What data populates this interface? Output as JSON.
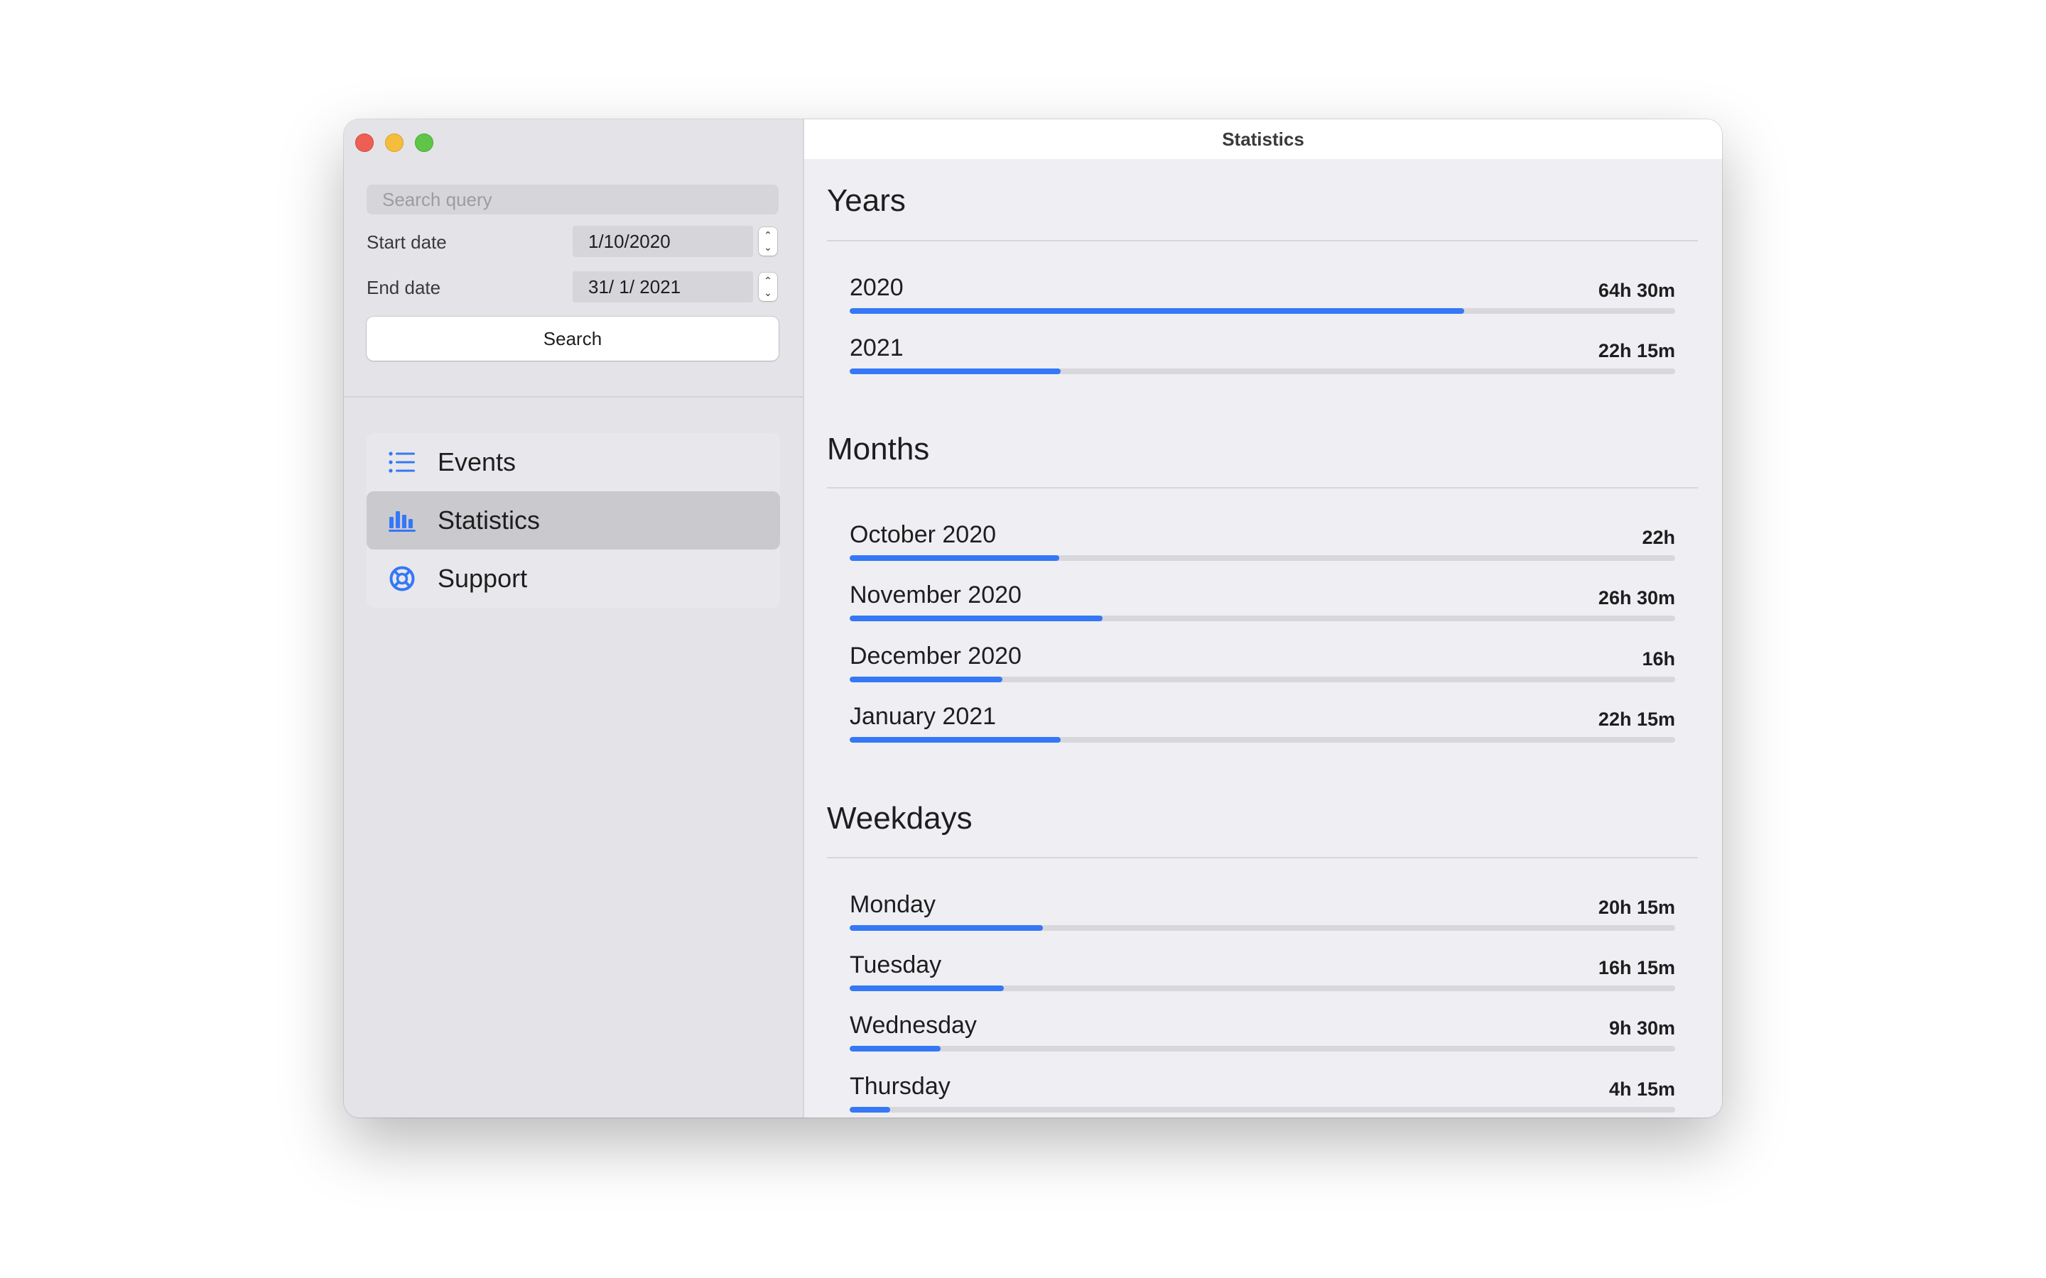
{
  "window_title": "Statistics",
  "colors": {
    "accent": "#3478f6",
    "close": "#ed5f55",
    "minimize": "#f4bd3b",
    "maximize": "#5ec548"
  },
  "sidebar": {
    "search": {
      "placeholder": "Search query",
      "value": ""
    },
    "start_date": {
      "label": "Start date",
      "value": "1/10/2020"
    },
    "end_date": {
      "label": "End date",
      "value": "31/  1/ 2021"
    },
    "search_button": "Search",
    "nav": [
      {
        "label": "Events",
        "icon": "list-icon",
        "selected": false
      },
      {
        "label": "Statistics",
        "icon": "bar-chart-icon",
        "selected": true
      },
      {
        "label": "Support",
        "icon": "lifebuoy-icon",
        "selected": false
      }
    ]
  },
  "main": {
    "years": {
      "title": "Years",
      "rows": [
        {
          "label": "2020",
          "value": "64h 30m",
          "fraction": 0.744
        },
        {
          "label": "2021",
          "value": "22h 15m",
          "fraction": 0.256
        }
      ]
    },
    "months": {
      "title": "Months",
      "rows": [
        {
          "label": "October 2020",
          "value": "22h",
          "fraction": 0.254
        },
        {
          "label": "November 2020",
          "value": "26h 30m",
          "fraction": 0.306
        },
        {
          "label": "December 2020",
          "value": "16h",
          "fraction": 0.185
        },
        {
          "label": "January 2021",
          "value": "22h 15m",
          "fraction": 0.256
        }
      ]
    },
    "weekdays": {
      "title": "Weekdays",
      "rows": [
        {
          "label": "Monday",
          "value": "20h 15m",
          "fraction": 0.234
        },
        {
          "label": "Tuesday",
          "value": "16h 15m",
          "fraction": 0.187
        },
        {
          "label": "Wednesday",
          "value": "9h 30m",
          "fraction": 0.11
        },
        {
          "label": "Thursday",
          "value": "4h 15m",
          "fraction": 0.049
        }
      ]
    }
  }
}
